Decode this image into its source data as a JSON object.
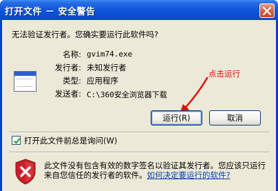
{
  "window": {
    "title": "打开文件 － 安全警告"
  },
  "dialog": {
    "question": "无法验证发行者。您确实要运行此软件吗?",
    "fields": [
      {
        "label": "名称:",
        "value": "gvim74.exe"
      },
      {
        "label": "发行者:",
        "value": "未知发行者"
      },
      {
        "label": "类型:",
        "value": "应用程序"
      },
      {
        "label": "发送者:",
        "value": "C:\\360安全浏览器下载"
      }
    ],
    "annotation": "点击运行",
    "run_label": "运行(R)",
    "cancel_label": "取消",
    "checkbox_label": "打开此文件前总是询问(W)",
    "checkbox_checked": true,
    "warning_text": "此文件没有包含有效的数字签名以验证其发行者。您应该只运行来自您信任的发行者的软件。",
    "warning_link": "如何决定要运行的软件?"
  },
  "colors": {
    "annotation": "#e01010",
    "title_bar": "#0a4fd6",
    "client_bg": "#ece9d8"
  }
}
